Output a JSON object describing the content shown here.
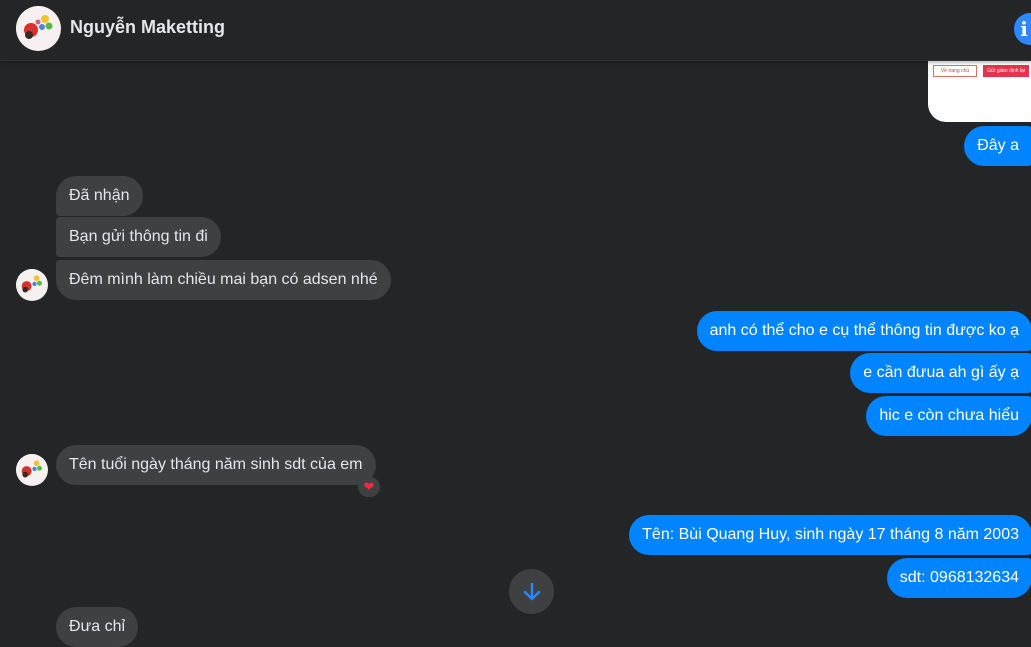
{
  "header": {
    "contact_name": "Nguyễn Maketting",
    "info_icon": "info-icon",
    "info_glyph": "i"
  },
  "image_attachment": {
    "button_left": "Về trang chủ",
    "button_right": "Gửi giám định lại"
  },
  "messages": {
    "m1": "Đây a",
    "m2": "Đã nhận",
    "m3": "Bạn gửi thông tin đi",
    "m4": "Đêm mình làm chiều mai bạn có adsen nhé",
    "m5": "anh có thể cho e cụ thể thông tin được ko ạ",
    "m6": "e cần đưua ah gì ấy ạ",
    "m7": "hic e còn chưa hiểu",
    "m8": "Tên tuổi ngày tháng năm sinh sdt của em",
    "m9": "Tên: Bùi Quang Huy, sinh ngày 17 tháng 8 năm 2003",
    "m10": "sdt: 0968132634",
    "m11": "Đưa chỉ"
  },
  "reaction": {
    "glyph": "❤",
    "icon": "heart-icon"
  },
  "scroll_button": {
    "icon": "arrow-down-icon"
  },
  "colors": {
    "background": "#242526",
    "incoming_bubble": "#3e4042",
    "outgoing_bubble": "#0084ff",
    "accent": "#2d88ff"
  }
}
